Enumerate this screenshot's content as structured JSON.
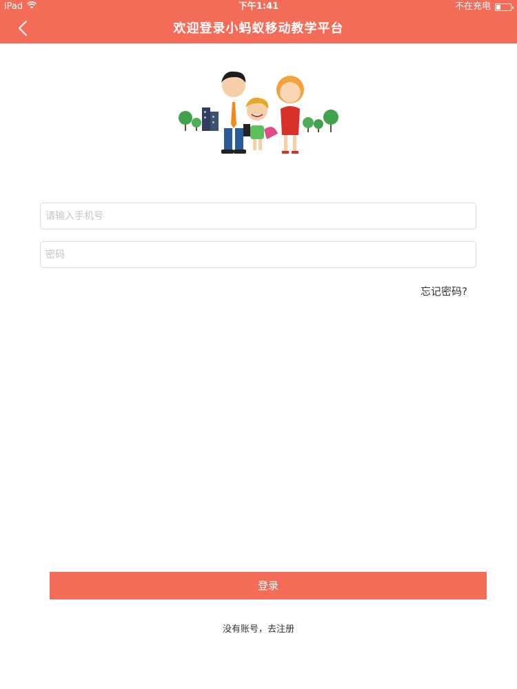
{
  "status_bar": {
    "device": "iPad",
    "time": "下午1:41",
    "charging": "不在充电"
  },
  "nav": {
    "title": "欢迎登录小蚂蚁移动教学平台"
  },
  "form": {
    "phone_placeholder": "请输入手机号",
    "password_placeholder": "密码",
    "forgot_label": "忘记密码?",
    "login_label": "登录",
    "register_label": "没有账号，去注册"
  },
  "colors": {
    "accent": "#f46b58"
  }
}
